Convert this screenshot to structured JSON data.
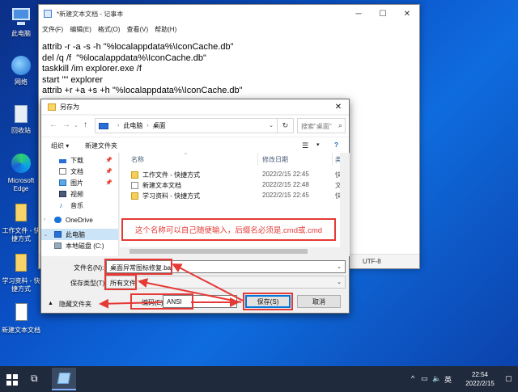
{
  "desktop": {
    "icons": [
      {
        "label": "此电脑"
      },
      {
        "label": "网络"
      },
      {
        "label": "回收站"
      },
      {
        "label": "Microsoft Edge"
      },
      {
        "label": "工作文件 - 快捷方式"
      },
      {
        "label": "学习资料 - 快捷方式"
      },
      {
        "label": "新建文本文档"
      }
    ]
  },
  "notepad": {
    "title": "*新建文本文档 - 记事本",
    "menu": [
      "文件(F)",
      "编辑(E)",
      "格式(O)",
      "查看(V)",
      "帮助(H)"
    ],
    "lines": [
      "attrib -r -a -s -h \"%localappdata%\\IconCache.db\"",
      "del /q /f  \"%localappdata%\\IconCache.db\"",
      "taskkill /im explorer.exe /f",
      "start \"\" explorer",
      "attrib +r +a +s +h \"%localappdata%\\IconCache.db\""
    ],
    "status_encoding": "UTF-8"
  },
  "dialog": {
    "title": "另存为",
    "address": {
      "root": "此电脑",
      "folder": "桌面"
    },
    "search_placeholder": "搜索\"桌面\"",
    "toolbar": {
      "organize": "组织 ▾",
      "new_folder": "新建文件夹"
    },
    "nav_items": [
      {
        "label": "下载"
      },
      {
        "label": "文档"
      },
      {
        "label": "图片"
      },
      {
        "label": "视频"
      },
      {
        "label": "音乐"
      },
      {
        "label": "OneDrive"
      },
      {
        "label": "此电脑"
      },
      {
        "label": "本地磁盘 (C:)"
      }
    ],
    "columns": {
      "name": "名称",
      "date": "修改日期",
      "type": "类型"
    },
    "files": [
      {
        "name": "工作文件 - 快捷方式",
        "date": "2022/2/15 22:45",
        "type": "快捷"
      },
      {
        "name": "新建文本文档",
        "date": "2022/2/15 22:48",
        "type": "文本"
      },
      {
        "name": "学习资料 - 快捷方式",
        "date": "2022/2/15 22:45",
        "type": "快捷"
      }
    ],
    "filename_label": "文件名(N):",
    "filename_value": "桌面异常图标修复.bat",
    "filetype_label": "保存类型(T):",
    "filetype_value": "所有文件",
    "hide_folders": "隐藏文件夹",
    "encoding_label": "编码(E):",
    "encoding_value": "ANSI",
    "save_button": "保存(S)",
    "cancel_button": "取消"
  },
  "annotation": "这个名称可以自己随便输入，后缀名必须是.cmd或.cmd",
  "taskbar": {
    "ime": "英",
    "time": "22:54",
    "date": "2022/2/15"
  },
  "colors": {
    "accent": "#0078d7",
    "annotation_red": "#e53935"
  }
}
